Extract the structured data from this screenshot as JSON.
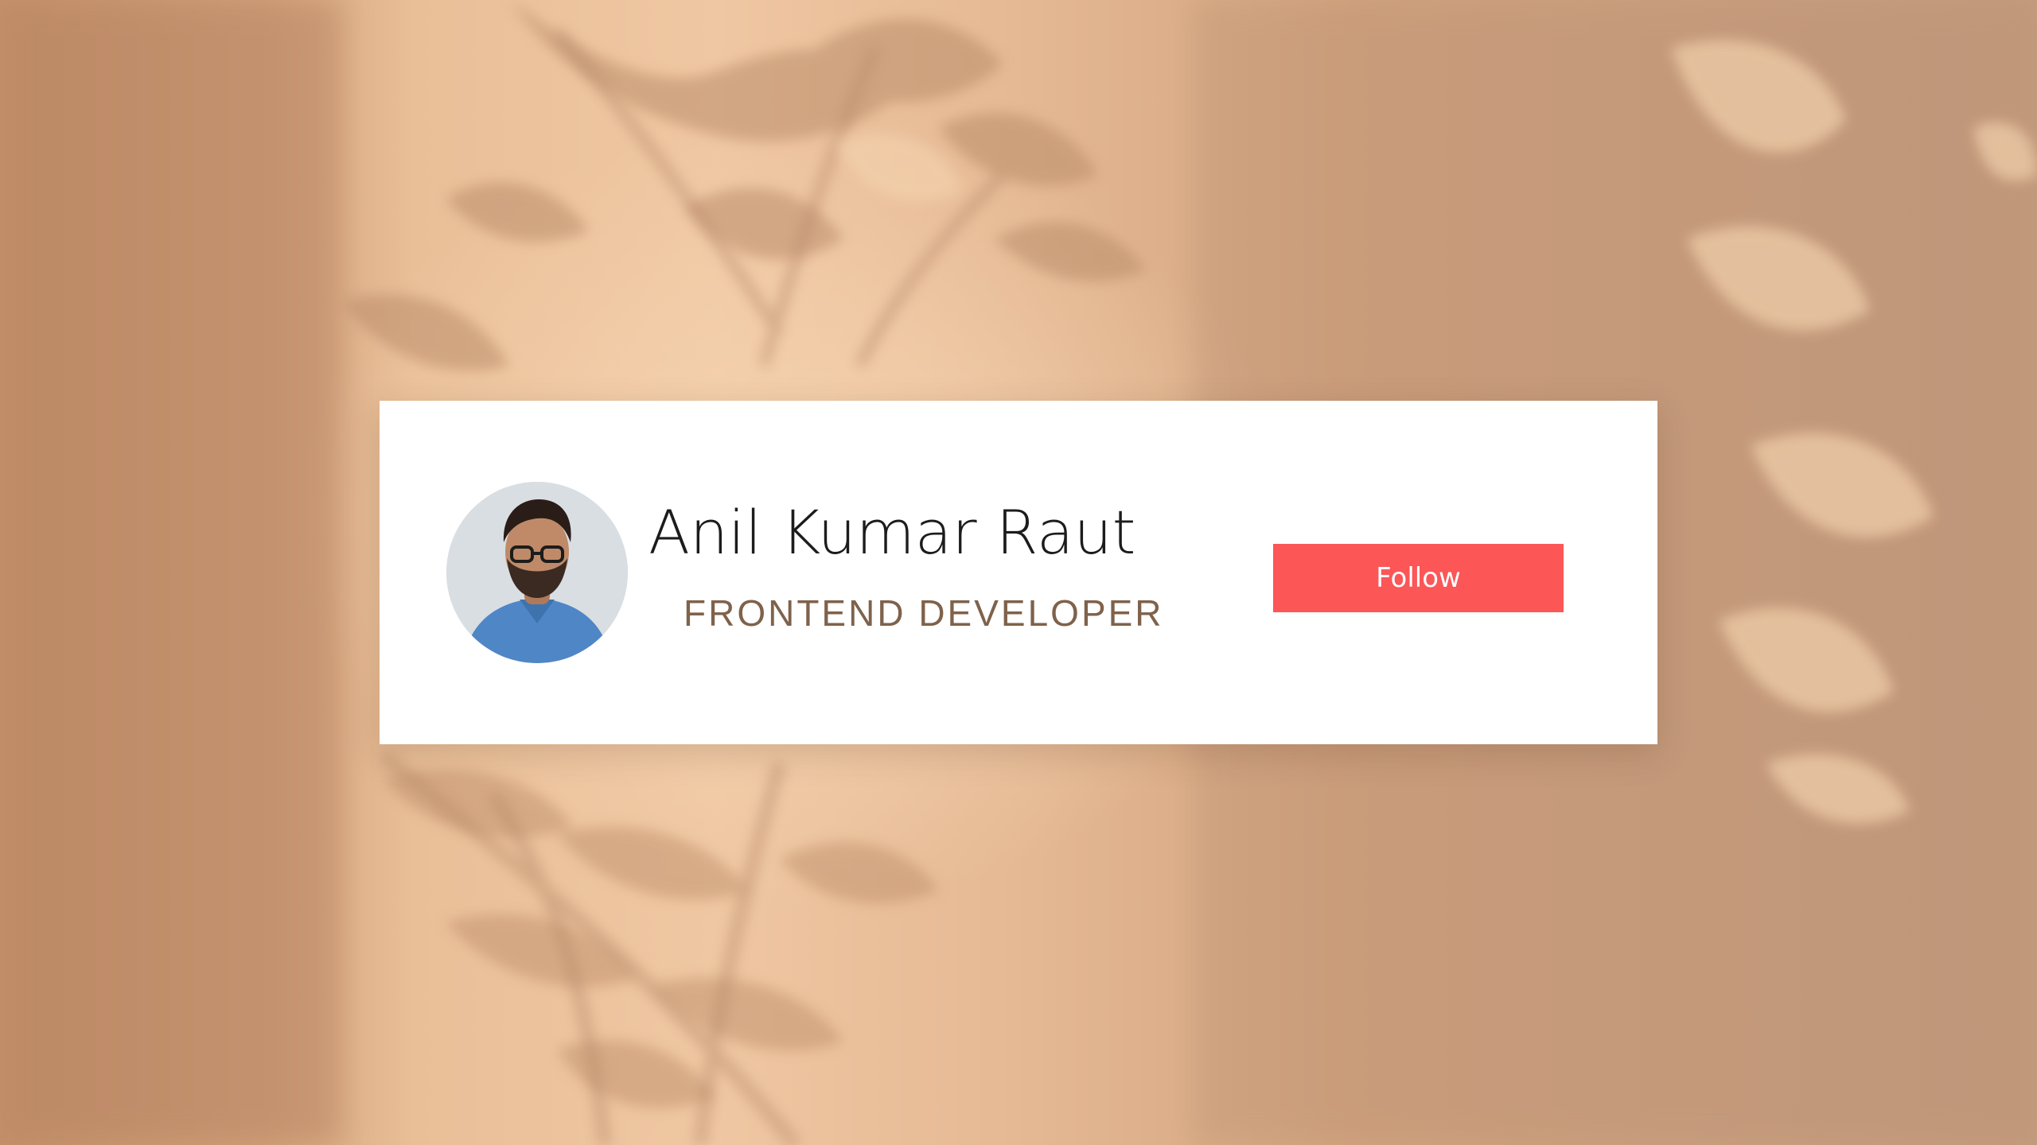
{
  "profile_card": {
    "name": "Anil Kumar Raut",
    "role": "FRONTEND DEVELOPER",
    "follow_label": "Follow"
  },
  "colors": {
    "background": "#e2b48e",
    "card": "#ffffff",
    "name_text": "#1c1c1c",
    "role_text": "#7f624b",
    "follow_button": "#fc5657",
    "follow_text": "#ffffff"
  },
  "icons": {
    "avatar": "profile-photo"
  }
}
